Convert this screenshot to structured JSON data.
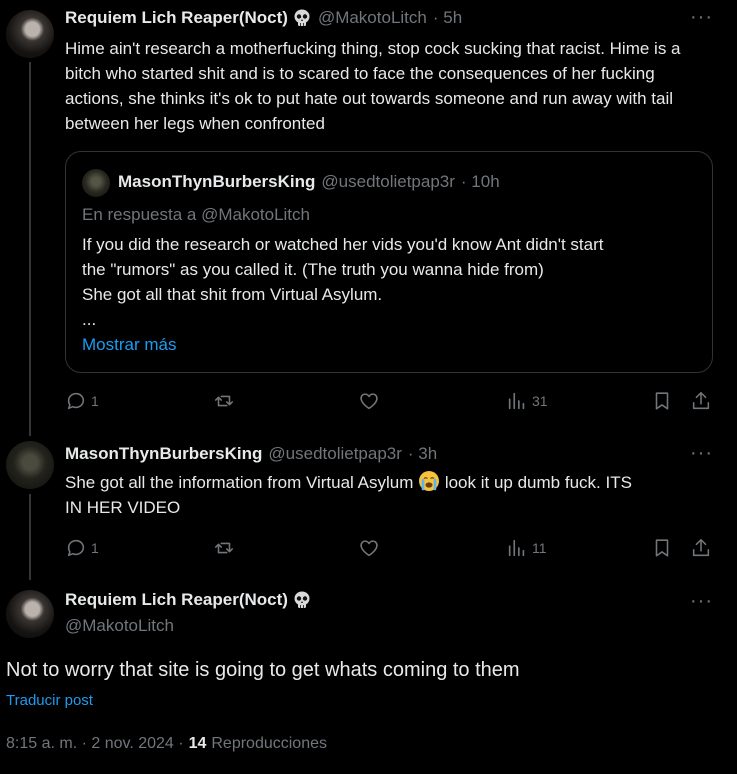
{
  "post1": {
    "name": "Requiem Lich Reaper(Noct)",
    "handle": "@MakotoLitch",
    "time": "· 5h",
    "text": "Hime ain't research a motherfucking thing, stop cock sucking that racist. Hime is a bitch who started shit and is to scared to face the consequences of her fucking actions, she thinks it's ok to put hate out towards someone and run away with tail between her legs when confronted",
    "quote": {
      "name": "MasonThynBurbersKing",
      "handle": "@usedtolietpap3r",
      "time": "· 10h",
      "reply_to": "En respuesta a @MakotoLitch",
      "line1": "If you did the research or watched her vids you'd know Ant didn't start",
      "line2": "the \"rumors\" as you called it. (The truth you wanna hide from)",
      "line3": "She got all that shit from Virtual Asylum.",
      "line4": "...",
      "show_more": "Mostrar más"
    },
    "replies": "1",
    "views": "31"
  },
  "post2": {
    "name": "MasonThynBurbersKing",
    "handle": "@usedtolietpap3r",
    "time": "· 3h",
    "text_a": "She got all the information from Virtual Asylum",
    "text_b": "look it up dumb fuck. ITS",
    "text_c": "IN HER VIDEO",
    "replies": "1",
    "views": "11"
  },
  "main": {
    "name": "Requiem Lich Reaper(Noct)",
    "handle": "@MakotoLitch",
    "text": "Not to worry that site is going to get whats coming to them",
    "translate": "Traducir post",
    "timestamp": "8:15 a. m. · 2 nov. 2024 ·",
    "view_count": "14",
    "views_label": "Reproducciones"
  },
  "more_glyph": "···",
  "colors": {
    "bg": "#000000",
    "text": "#e7e9ea",
    "muted": "#71767b",
    "link": "#1d9bf0",
    "border": "#2f3336"
  }
}
